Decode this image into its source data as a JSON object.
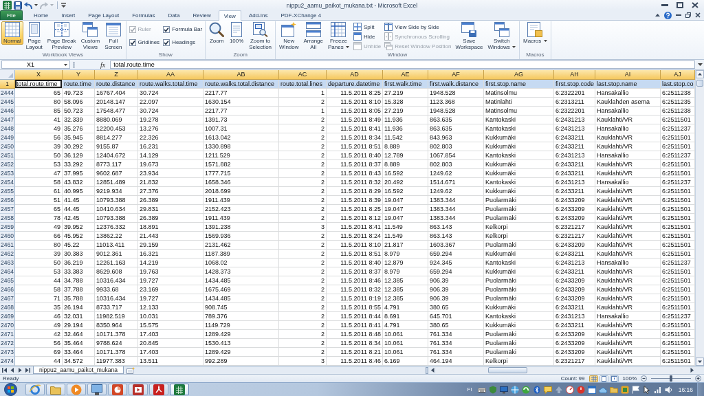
{
  "window": {
    "title": "nippu2_aamu_paikot_mukana.txt - Microsoft Excel"
  },
  "quick_access": [
    {
      "kind": "save",
      "disabled": false
    },
    {
      "kind": "undo",
      "disabled": false,
      "dropdown": true
    },
    {
      "kind": "redo",
      "disabled": true,
      "dropdown": true
    },
    {
      "kind": "customize"
    }
  ],
  "ribbon": {
    "tabs": [
      {
        "label": "File",
        "kind": "file",
        "selected": false
      },
      {
        "label": "Home",
        "kind": "tab",
        "selected": false
      },
      {
        "label": "Insert",
        "kind": "tab",
        "selected": false
      },
      {
        "label": "Page Layout",
        "kind": "tab",
        "selected": false
      },
      {
        "label": "Formulas",
        "kind": "tab",
        "selected": false
      },
      {
        "label": "Data",
        "kind": "tab",
        "selected": false
      },
      {
        "label": "Review",
        "kind": "tab",
        "selected": false
      },
      {
        "label": "View",
        "kind": "tab",
        "selected": true
      },
      {
        "label": "Add-Ins",
        "kind": "tab",
        "selected": false
      },
      {
        "label": "PDF-XChange 4",
        "kind": "tab",
        "selected": false
      }
    ],
    "groups": [
      {
        "label": "Workbook Views",
        "items": [
          {
            "kind": "large",
            "label": "Normal",
            "selected": true
          },
          {
            "kind": "large",
            "label": "Page\nLayout",
            "selected": false
          },
          {
            "kind": "large",
            "label": "Page Break\nPreview",
            "selected": false
          },
          {
            "kind": "large",
            "label": "Custom\nViews",
            "selected": false
          },
          {
            "kind": "large",
            "label": "Full\nScreen",
            "selected": false
          }
        ]
      },
      {
        "label": "Show",
        "items": [
          {
            "kind": "checkbox",
            "label": "Ruler",
            "checked": true,
            "disabled": true
          },
          {
            "kind": "checkbox",
            "label": "Gridlines",
            "checked": true,
            "disabled": false
          },
          {
            "kind": "checkbox",
            "label": "Formula Bar",
            "checked": true,
            "disabled": false
          },
          {
            "kind": "checkbox",
            "label": "Headings",
            "checked": true,
            "disabled": false
          }
        ]
      },
      {
        "label": "Zoom",
        "items": [
          {
            "kind": "large",
            "label": "Zoom"
          },
          {
            "kind": "large",
            "label": "100%"
          },
          {
            "kind": "large",
            "label": "Zoom to\nSelection"
          }
        ]
      },
      {
        "label": "Window",
        "items": [
          {
            "kind": "large",
            "label": "New\nWindow"
          },
          {
            "kind": "large",
            "label": "Arrange\nAll"
          },
          {
            "kind": "large",
            "label": "Freeze\nPanes",
            "dropdown": true
          },
          {
            "kind": "small",
            "label": "Split",
            "disabled": false
          },
          {
            "kind": "small",
            "label": "Hide",
            "disabled": false
          },
          {
            "kind": "small",
            "label": "Unhide",
            "disabled": true
          },
          {
            "kind": "small",
            "label": "View Side by Side",
            "disabled": false
          },
          {
            "kind": "small",
            "label": "Synchronous Scrolling",
            "disabled": true
          },
          {
            "kind": "small",
            "label": "Reset Window Position",
            "disabled": true
          },
          {
            "kind": "large",
            "label": "Save\nWorkspace"
          },
          {
            "kind": "large",
            "label": "Switch\nWindows",
            "dropdown": true
          }
        ]
      },
      {
        "label": "Macros",
        "items": [
          {
            "kind": "large",
            "label": "Macros",
            "dropdown": true
          }
        ]
      }
    ]
  },
  "formula_bar": {
    "name_box": "X1",
    "function_label": "fx",
    "formula": "total.route.time"
  },
  "sheet": {
    "columns": [
      {
        "letter": "X",
        "selected": true,
        "kind": "number"
      },
      {
        "letter": "Y",
        "selected": true,
        "kind": "text"
      },
      {
        "letter": "Z",
        "selected": true,
        "kind": "text"
      },
      {
        "letter": "AA",
        "selected": true,
        "kind": "text"
      },
      {
        "letter": "AB",
        "selected": true,
        "kind": "text"
      },
      {
        "letter": "AC",
        "selected": true,
        "kind": "number"
      },
      {
        "letter": "AD",
        "selected": true,
        "kind": "number"
      },
      {
        "letter": "AE",
        "selected": true,
        "kind": "text"
      },
      {
        "letter": "AF",
        "selected": true,
        "kind": "text"
      },
      {
        "letter": "AG",
        "selected": true,
        "kind": "text"
      },
      {
        "letter": "AH",
        "selected": true,
        "kind": "text"
      },
      {
        "letter": "AI",
        "selected": true,
        "kind": "text"
      },
      {
        "letter": "AJ",
        "selected": true,
        "kind": "text"
      }
    ],
    "header_row": {
      "number": "1",
      "selected": true,
      "cells": [
        {
          "text": "total.route.time",
          "active": true
        },
        {
          "text": "route.time",
          "active": false
        },
        {
          "text": "route.distance",
          "active": false
        },
        {
          "text": "route.walks.total.time",
          "active": false
        },
        {
          "text": "route.walks.total.distance",
          "active": false
        },
        {
          "text": "route.total.lines",
          "active": false
        },
        {
          "text": "departure.datetime",
          "active": false
        },
        {
          "text": "first.walk.time",
          "active": false
        },
        {
          "text": "first.walk.distance",
          "active": false
        },
        {
          "text": "first.stop.name",
          "active": false
        },
        {
          "text": "first.stop.code",
          "active": false
        },
        {
          "text": "last.stop.name",
          "active": false
        },
        {
          "text": "last.stop.co",
          "active": false
        }
      ]
    },
    "rows": [
      {
        "number": "2444",
        "selected": false,
        "cells": [
          "65",
          "49.723",
          "16767.404",
          "30.724",
          "2217.77",
          "1",
          "11.5.2011 8:25",
          "27.219",
          "1948.528",
          "Matinsolmu",
          "6:2322201",
          "Hansakallio",
          "6:2511238"
        ]
      },
      {
        "number": "2445",
        "selected": false,
        "cells": [
          "80",
          "58.096",
          "20148.147",
          "22.097",
          "1630.154",
          "2",
          "11.5.2011 8:10",
          "15.328",
          "1123.368",
          "Matinlahti",
          "6:2313211",
          "Kauklahden asema",
          "6:2511235"
        ]
      },
      {
        "number": "2446",
        "selected": false,
        "cells": [
          "85",
          "50.723",
          "17548.477",
          "30.724",
          "2217.77",
          "1",
          "11.5.2011 8:05",
          "27.219",
          "1948.528",
          "Matinsolmu",
          "6:2322201",
          "Hansakallio",
          "6:2511238"
        ]
      },
      {
        "number": "2447",
        "selected": false,
        "cells": [
          "41",
          "32.339",
          "8880.069",
          "19.278",
          "1391.73",
          "2",
          "11.5.2011 8:49",
          "11.936",
          "863.635",
          "Kantokaski",
          "6:2431213",
          "Kauklahti/VR",
          "6:2511501"
        ]
      },
      {
        "number": "2448",
        "selected": false,
        "cells": [
          "49",
          "35.276",
          "12200.453",
          "13.276",
          "1007.31",
          "2",
          "11.5.2011 8:41",
          "11.936",
          "863.635",
          "Kantokaski",
          "6:2431213",
          "Hansakallio",
          "6:2511237"
        ]
      },
      {
        "number": "2449",
        "selected": false,
        "cells": [
          "56",
          "35.945",
          "8814.277",
          "22.326",
          "1613.042",
          "2",
          "11.5.2011 8:34",
          "11.542",
          "843.963",
          "Kukkumäki",
          "6:2433211",
          "Kauklahti/VR",
          "6:2511501"
        ]
      },
      {
        "number": "2450",
        "selected": false,
        "cells": [
          "39",
          "30.292",
          "9155.87",
          "16.231",
          "1330.898",
          "2",
          "11.5.2011 8:51",
          "8.889",
          "802.803",
          "Kukkumäki",
          "6:2433211",
          "Kauklahti/VR",
          "6:2511501"
        ]
      },
      {
        "number": "2451",
        "selected": false,
        "cells": [
          "50",
          "36.129",
          "12404.672",
          "14.129",
          "1211.529",
          "2",
          "11.5.2011 8:40",
          "12.789",
          "1067.854",
          "Kantokaski",
          "6:2431213",
          "Hansakallio",
          "6:2511237"
        ]
      },
      {
        "number": "2452",
        "selected": false,
        "cells": [
          "53",
          "33.292",
          "8773.117",
          "19.673",
          "1571.882",
          "2",
          "11.5.2011 8:37",
          "8.889",
          "802.803",
          "Kukkumäki",
          "6:2433211",
          "Kauklahti/VR",
          "6:2511501"
        ]
      },
      {
        "number": "2453",
        "selected": false,
        "cells": [
          "47",
          "37.995",
          "9602.687",
          "23.934",
          "1777.715",
          "2",
          "11.5.2011 8:43",
          "16.592",
          "1249.62",
          "Kukkumäki",
          "6:2433211",
          "Kauklahti/VR",
          "6:2511501"
        ]
      },
      {
        "number": "2454",
        "selected": false,
        "cells": [
          "58",
          "43.832",
          "12851.489",
          "21.832",
          "1658.346",
          "2",
          "11.5.2011 8:32",
          "20.492",
          "1514.671",
          "Kantokaski",
          "6:2431213",
          "Hansakallio",
          "6:2511237"
        ]
      },
      {
        "number": "2455",
        "selected": false,
        "cells": [
          "61",
          "40.995",
          "9219.934",
          "27.376",
          "2018.699",
          "2",
          "11.5.2011 8:29",
          "16.592",
          "1249.62",
          "Kukkumäki",
          "6:2433211",
          "Kauklahti/VR",
          "6:2511501"
        ]
      },
      {
        "number": "2456",
        "selected": false,
        "cells": [
          "51",
          "41.45",
          "10793.388",
          "26.389",
          "1911.439",
          "2",
          "11.5.2011 8:39",
          "19.047",
          "1383.344",
          "Puolarmäki",
          "6:2433209",
          "Kauklahti/VR",
          "6:2511501"
        ]
      },
      {
        "number": "2457",
        "selected": false,
        "cells": [
          "65",
          "44.45",
          "10410.634",
          "29.831",
          "2152.423",
          "2",
          "11.5.2011 8:25",
          "19.047",
          "1383.344",
          "Puolarmäki",
          "6:2433209",
          "Kauklahti/VR",
          "6:2511501"
        ]
      },
      {
        "number": "2458",
        "selected": false,
        "cells": [
          "78",
          "42.45",
          "10793.388",
          "26.389",
          "1911.439",
          "2",
          "11.5.2011 8:12",
          "19.047",
          "1383.344",
          "Puolarmäki",
          "6:2433209",
          "Kauklahti/VR",
          "6:2511501"
        ]
      },
      {
        "number": "2459",
        "selected": false,
        "cells": [
          "49",
          "39.952",
          "12376.332",
          "18.891",
          "1391.238",
          "3",
          "11.5.2011 8:41",
          "11.549",
          "863.143",
          "Kelkorpi",
          "6:2321217",
          "Kauklahti/VR",
          "6:2511501"
        ]
      },
      {
        "number": "2460",
        "selected": false,
        "cells": [
          "66",
          "45.952",
          "13862.22",
          "21.443",
          "1569.936",
          "2",
          "11.5.2011 8:24",
          "11.549",
          "863.143",
          "Kelkorpi",
          "6:2321217",
          "Kauklahti/VR",
          "6:2511501"
        ]
      },
      {
        "number": "2461",
        "selected": false,
        "cells": [
          "80",
          "45.22",
          "11013.411",
          "29.159",
          "2131.462",
          "2",
          "11.5.2011 8:10",
          "21.817",
          "1603.367",
          "Puolarmäki",
          "6:2433209",
          "Kauklahti/VR",
          "6:2511501"
        ]
      },
      {
        "number": "2462",
        "selected": false,
        "cells": [
          "39",
          "30.383",
          "9012.361",
          "16.321",
          "1187.389",
          "2",
          "11.5.2011 8:51",
          "8.979",
          "659.294",
          "Kukkumäki",
          "6:2433211",
          "Kauklahti/VR",
          "6:2511501"
        ]
      },
      {
        "number": "2463",
        "selected": false,
        "cells": [
          "50",
          "36.219",
          "12261.163",
          "14.219",
          "1068.02",
          "2",
          "11.5.2011 8:40",
          "12.879",
          "924.345",
          "Kantokaski",
          "6:2431213",
          "Hansakallio",
          "6:2511237"
        ]
      },
      {
        "number": "2464",
        "selected": false,
        "cells": [
          "53",
          "33.383",
          "8629.608",
          "19.763",
          "1428.373",
          "2",
          "11.5.2011 8:37",
          "8.979",
          "659.294",
          "Kukkumäki",
          "6:2433211",
          "Kauklahti/VR",
          "6:2511501"
        ]
      },
      {
        "number": "2465",
        "selected": false,
        "cells": [
          "44",
          "34.788",
          "10316.434",
          "19.727",
          "1434.485",
          "2",
          "11.5.2011 8:46",
          "12.385",
          "906.39",
          "Puolarmäki",
          "6:2433209",
          "Kauklahti/VR",
          "6:2511501"
        ]
      },
      {
        "number": "2466",
        "selected": false,
        "cells": [
          "58",
          "37.788",
          "9933.68",
          "23.169",
          "1675.469",
          "2",
          "11.5.2011 8:32",
          "12.385",
          "906.39",
          "Puolarmäki",
          "6:2433209",
          "Kauklahti/VR",
          "6:2511501"
        ]
      },
      {
        "number": "2467",
        "selected": false,
        "cells": [
          "71",
          "35.788",
          "10316.434",
          "19.727",
          "1434.485",
          "2",
          "11.5.2011 8:19",
          "12.385",
          "906.39",
          "Puolarmäki",
          "6:2433209",
          "Kauklahti/VR",
          "6:2511501"
        ]
      },
      {
        "number": "2468",
        "selected": false,
        "cells": [
          "35",
          "26.194",
          "8733.717",
          "12.133",
          "908.745",
          "2",
          "11.5.2011 8:55",
          "4.791",
          "380.65",
          "Kukkumäki",
          "6:2433211",
          "Kauklahti/VR",
          "6:2511501"
        ]
      },
      {
        "number": "2469",
        "selected": false,
        "cells": [
          "46",
          "32.031",
          "11982.519",
          "10.031",
          "789.376",
          "2",
          "11.5.2011 8:44",
          "8.691",
          "645.701",
          "Kantokaski",
          "6:2431213",
          "Hansakallio",
          "6:2511237"
        ]
      },
      {
        "number": "2470",
        "selected": false,
        "cells": [
          "49",
          "29.194",
          "8350.964",
          "15.575",
          "1149.729",
          "2",
          "11.5.2011 8:41",
          "4.791",
          "380.65",
          "Kukkumäki",
          "6:2433211",
          "Kauklahti/VR",
          "6:2511501"
        ]
      },
      {
        "number": "2471",
        "selected": false,
        "cells": [
          "42",
          "32.464",
          "10171.378",
          "17.403",
          "1289.429",
          "2",
          "11.5.2011 8:48",
          "10.061",
          "761.334",
          "Puolarmäki",
          "6:2433209",
          "Kauklahti/VR",
          "6:2511501"
        ]
      },
      {
        "number": "2472",
        "selected": false,
        "cells": [
          "56",
          "35.464",
          "9788.624",
          "20.845",
          "1530.413",
          "2",
          "11.5.2011 8:34",
          "10.061",
          "761.334",
          "Puolarmäki",
          "6:2433209",
          "Kauklahti/VR",
          "6:2511501"
        ]
      },
      {
        "number": "2473",
        "selected": false,
        "cells": [
          "69",
          "33.464",
          "10171.378",
          "17.403",
          "1289.429",
          "2",
          "11.5.2011 8:21",
          "10.061",
          "761.334",
          "Puolarmäki",
          "6:2433209",
          "Kauklahti/VR",
          "6:2511501"
        ]
      },
      {
        "number": "2474",
        "selected": false,
        "cells": [
          "44",
          "34.572",
          "11977.383",
          "13.511",
          "992.289",
          "3",
          "11.5.2011 8:46",
          "6.169",
          "464.194",
          "Kelkorpi",
          "6:2321217",
          "Kauklahti/VR",
          "6:2511501"
        ]
      }
    ]
  },
  "sheet_tabs": [
    {
      "label": "nippu2_aamu_paikot_mukana",
      "selected": true
    }
  ],
  "status_bar": {
    "mode": "Ready",
    "count": "Count: 99",
    "view_buttons": [
      {
        "selected": true
      },
      {
        "selected": false
      },
      {
        "selected": false
      }
    ],
    "zoom": "100%",
    "zoom_slider": {
      "level": 0.5
    }
  },
  "taskbar": {
    "buttons": [
      {
        "selected": false
      },
      {
        "selected": false
      },
      {
        "selected": false
      },
      {
        "selected": false
      },
      {
        "selected": false
      },
      {
        "selected": false
      },
      {
        "selected": false
      },
      {
        "selected": true
      }
    ],
    "language": "FI",
    "clock": "16:16"
  }
}
